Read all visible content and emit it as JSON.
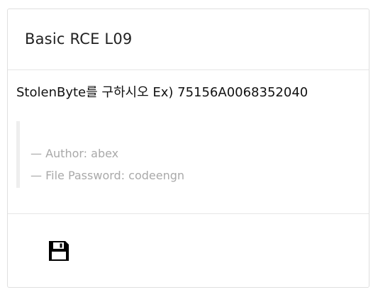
{
  "card": {
    "title": "Basic RCE L09",
    "description": "StolenByte를 구하시오 Ex) 75156A0068352040",
    "quote": {
      "author": "— Author: abex",
      "password": "— File Password: codeengn"
    },
    "footer": {
      "download_icon": "floppy-disk-icon"
    }
  }
}
